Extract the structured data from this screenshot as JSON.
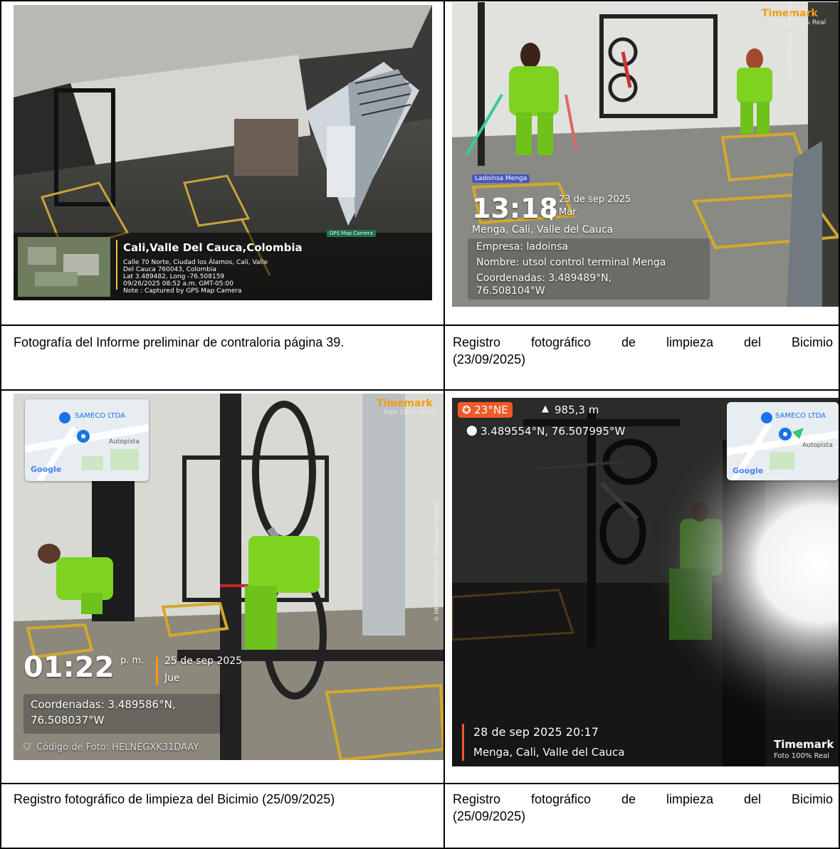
{
  "captions": {
    "c1": "Fotografía del Informe preliminar de contraloria página 39.",
    "c2_line1": [
      "Registro",
      "fotográfico",
      "de",
      "limpieza",
      "del",
      "Bicimio"
    ],
    "c2_line2": "(23/09/2025)",
    "c3": "Registro fotográfico de limpieza del Bicimio (25/09/2025)",
    "c4_line1": [
      "Registro",
      "fotográfico",
      "de",
      "limpieza",
      "del",
      "Bicimio"
    ],
    "c4_line2": "(25/09/2025)"
  },
  "photo1": {
    "location_title": "Cali,Valle Del Cauca,Colombia",
    "address_lines": [
      "Calle 70 Norte, Ciudad los Álamos, Cali, Valle",
      "Del Cauca 760043, Colombia",
      "Lat 3.489482, Long -76.508159",
      "09/26/2025 08:52 a.m. GMT-05:00",
      "Note : Captured by GPS Map Camera"
    ],
    "badge": "GPS Map Camera"
  },
  "photo2": {
    "brand": "Timemark",
    "brand_sub": "Foto 100% Real",
    "tag": "Ladoinsa Menga",
    "time": "13:18",
    "date": "23 de sep 2025",
    "weekday": "Mar",
    "place": "Menga, Cali, Valle del Cauca",
    "empresa": "Empresa: ladoinsa",
    "nombre": "Nombre: utsol control terminal Menga",
    "coord1": "Coordenadas: 3.489489°N,",
    "coord2": "76.508104°W",
    "side_text": "© RL1Y4KMKH5G9 · Timemark Verified"
  },
  "photo3": {
    "brand": "Timemark",
    "brand_sub": "Foto 100% Real",
    "map_label": "SAMECO LTDA",
    "map_road": "Autopista",
    "map_google": "Google",
    "time": "01:22",
    "ampm": "p. m.",
    "date": "25 de sep 2025",
    "weekday": "Jue",
    "coord1": "Coordenadas: 3.489586°N,",
    "coord2": "76.508037°W",
    "code": "Código de Foto: HELNEGXK31DAAY",
    "side_text": "© HELNEGXK31DAAY · Timemark Verified"
  },
  "photo4": {
    "heading": "23°NE",
    "altitude": "985,3 m",
    "coords": "3.489554°N, 76.507995°W",
    "map_label": "SAMECO LTDA",
    "map_road": "Autopista",
    "map_google": "Google",
    "datetime": "28 de sep 2025 20:17",
    "place": "Menga, Cali, Valle del Cauca",
    "brand": "Timemark",
    "brand_sub": "Foto 100% Real"
  },
  "colors": {
    "green_uniform": "#7ed321",
    "timemark_orange": "#f39c12",
    "pill_orange": "#f05a28",
    "google_blue": "#1a73e8"
  }
}
